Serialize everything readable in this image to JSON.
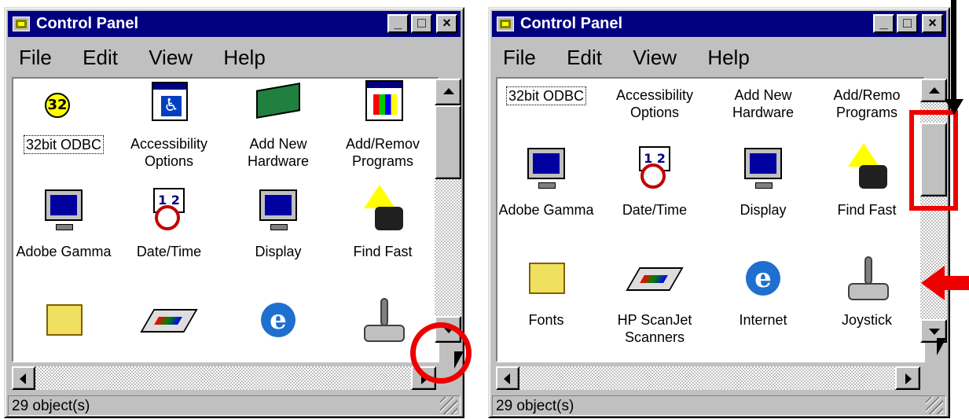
{
  "window": {
    "title": "Control Panel",
    "menu": [
      "File",
      "Edit",
      "View",
      "Help"
    ],
    "status": "29 object(s)"
  },
  "left_items": [
    {
      "label": "32bit ODBC",
      "icon": "odbc-icon"
    },
    {
      "label": "Accessibility Options",
      "icon": "accessibility-icon"
    },
    {
      "label": "Add New Hardware",
      "icon": "hardware-icon"
    },
    {
      "label": "Add/Remov Programs",
      "icon": "add-remove-icon"
    },
    {
      "label": "Adobe Gamma",
      "icon": "monitor-icon"
    },
    {
      "label": "Date/Time",
      "icon": "clock-icon"
    },
    {
      "label": "Display",
      "icon": "display-icon"
    },
    {
      "label": "Find Fast",
      "icon": "find-fast-icon"
    },
    {
      "label": "",
      "icon": "fonts-icon"
    },
    {
      "label": "",
      "icon": "scanner-icon"
    },
    {
      "label": "",
      "icon": "internet-icon"
    },
    {
      "label": "",
      "icon": "joystick-icon"
    }
  ],
  "right_items": [
    {
      "label": "32bit ODBC",
      "icon": "odbc-icon"
    },
    {
      "label": "Accessibility Options",
      "icon": "accessibility-icon"
    },
    {
      "label": "Add New Hardware",
      "icon": "hardware-icon"
    },
    {
      "label": "Add/Remo Programs",
      "icon": "add-remove-icon"
    },
    {
      "label": "Adobe Gamma",
      "icon": "monitor-icon"
    },
    {
      "label": "Date/Time",
      "icon": "clock-icon"
    },
    {
      "label": "Display",
      "icon": "display-icon"
    },
    {
      "label": "Find Fast",
      "icon": "find-fast-icon"
    },
    {
      "label": "Fonts",
      "icon": "fonts-icon"
    },
    {
      "label": "HP ScanJet Scanners",
      "icon": "scanner-icon"
    },
    {
      "label": "Internet",
      "icon": "internet-icon"
    },
    {
      "label": "Joystick",
      "icon": "joystick-icon"
    }
  ],
  "colors": {
    "titlebar": "#000080",
    "annotation": "#e00000"
  }
}
